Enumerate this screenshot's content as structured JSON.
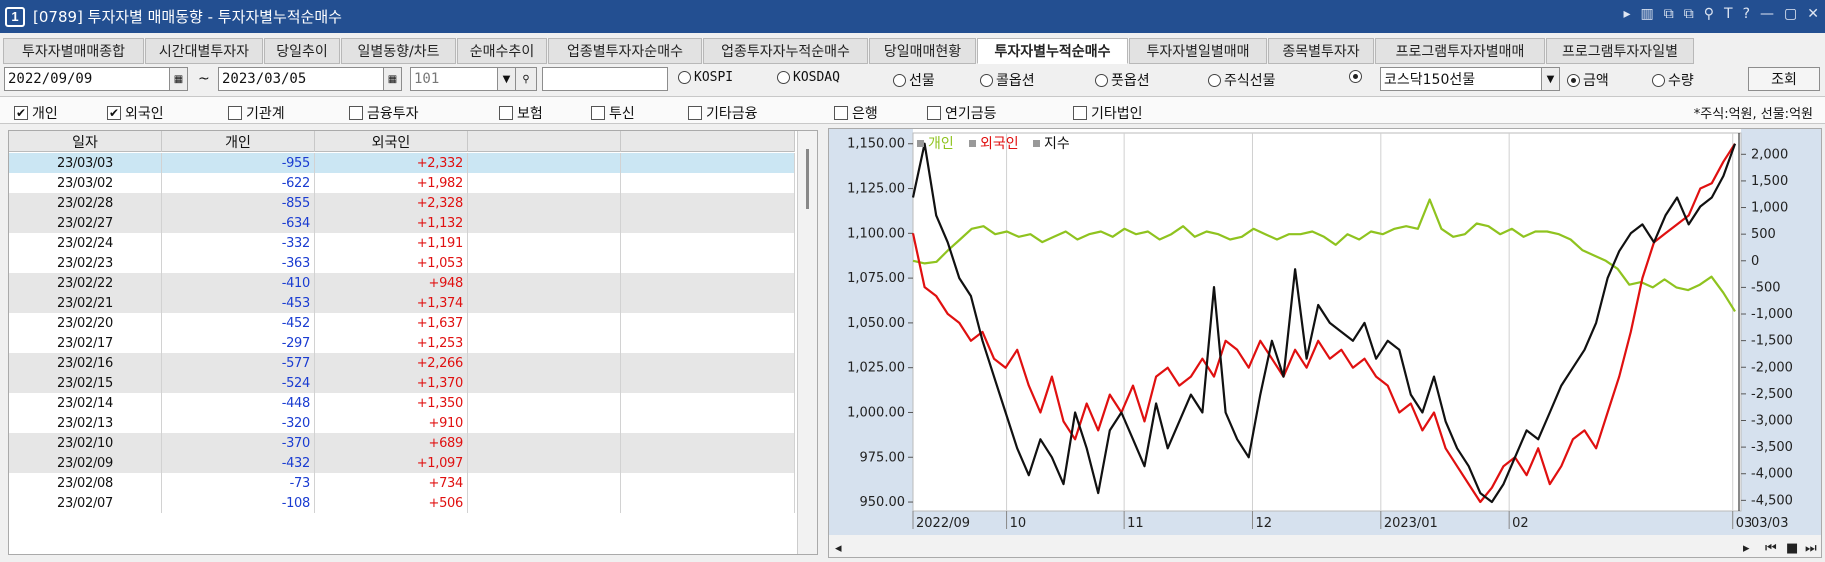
{
  "window": {
    "number": "1",
    "title": "[0789] 투자자별 매매동향 - 투자자별누적순매수",
    "controls": [
      "▸",
      "▥",
      "⧉",
      "⧉",
      "⚲",
      "T",
      "?",
      "—",
      "▢",
      "✕"
    ]
  },
  "tabs": [
    {
      "label": "투자자별매매종합",
      "active": false
    },
    {
      "label": "시간대별투자자",
      "active": false
    },
    {
      "label": "당일추이",
      "active": false
    },
    {
      "label": "일별동향/차트",
      "active": false
    },
    {
      "label": "순매수추이",
      "active": false
    },
    {
      "label": "업종별투자자순매수",
      "active": false
    },
    {
      "label": "업종투자자누적순매수",
      "active": false
    },
    {
      "label": "당일매매현황",
      "active": false
    },
    {
      "label": "투자자별누적순매수",
      "active": true
    },
    {
      "label": "투자자별일별매매",
      "active": false
    },
    {
      "label": "종목별투자자",
      "active": false
    },
    {
      "label": "프로그램투자자별매매",
      "active": false
    },
    {
      "label": "프로그램투자자일별",
      "active": false
    }
  ],
  "filter": {
    "start_date": "2022/09/09",
    "tilde": "~",
    "end_date": "2023/03/05",
    "code": "101",
    "radios": [
      {
        "label": "KOSPI",
        "selected": false
      },
      {
        "label": "KOSDAQ",
        "selected": false
      },
      {
        "label": "선물",
        "selected": false
      },
      {
        "label": "콜옵션",
        "selected": false
      },
      {
        "label": "풋옵션",
        "selected": false
      },
      {
        "label": "주식선물",
        "selected": false
      },
      {
        "label": "",
        "selected": true
      }
    ],
    "product": "코스닥150선물",
    "amount_label": "금액",
    "amount_selected": true,
    "qty_label": "수량",
    "qty_selected": false,
    "query_button": "조회"
  },
  "investors": [
    {
      "label": "개인",
      "checked": true
    },
    {
      "label": "외국인",
      "checked": true
    },
    {
      "label": "기관계",
      "checked": false
    },
    {
      "label": "금융투자",
      "checked": false
    },
    {
      "label": "보험",
      "checked": false
    },
    {
      "label": "투신",
      "checked": false
    },
    {
      "label": "기타금융",
      "checked": false
    },
    {
      "label": "은행",
      "checked": false
    },
    {
      "label": "연기금등",
      "checked": false
    },
    {
      "label": "기타법인",
      "checked": false
    }
  ],
  "unit_note": "*주식:억원, 선물:억원",
  "table": {
    "headers": [
      "일자",
      "개인",
      "외국인",
      "",
      ""
    ],
    "rows": [
      {
        "date": "23/03/03",
        "individual": "-955",
        "foreign": "+2,332"
      },
      {
        "date": "23/03/02",
        "individual": "-622",
        "foreign": "+1,982"
      },
      {
        "date": "23/02/28",
        "individual": "-855",
        "foreign": "+2,328"
      },
      {
        "date": "23/02/27",
        "individual": "-634",
        "foreign": "+1,132"
      },
      {
        "date": "23/02/24",
        "individual": "-332",
        "foreign": "+1,191"
      },
      {
        "date": "23/02/23",
        "individual": "-363",
        "foreign": "+1,053"
      },
      {
        "date": "23/02/22",
        "individual": "-410",
        "foreign": "+948"
      },
      {
        "date": "23/02/21",
        "individual": "-453",
        "foreign": "+1,374"
      },
      {
        "date": "23/02/20",
        "individual": "-452",
        "foreign": "+1,637"
      },
      {
        "date": "23/02/17",
        "individual": "-297",
        "foreign": "+1,253"
      },
      {
        "date": "23/02/16",
        "individual": "-577",
        "foreign": "+2,266"
      },
      {
        "date": "23/02/15",
        "individual": "-524",
        "foreign": "+1,370"
      },
      {
        "date": "23/02/14",
        "individual": "-448",
        "foreign": "+1,350"
      },
      {
        "date": "23/02/13",
        "individual": "-320",
        "foreign": "+910"
      },
      {
        "date": "23/02/10",
        "individual": "-370",
        "foreign": "+689"
      },
      {
        "date": "23/02/09",
        "individual": "-432",
        "foreign": "+1,097"
      },
      {
        "date": "23/02/08",
        "individual": "-73",
        "foreign": "+734"
      },
      {
        "date": "23/02/07",
        "individual": "-108",
        "foreign": "+506"
      }
    ]
  },
  "chart_data": {
    "type": "line",
    "legend": [
      "개인",
      "외국인",
      "지수"
    ],
    "x_labels": [
      "2022/09",
      "10",
      "11",
      "12",
      "2023/01",
      "02",
      "03",
      "03/03"
    ],
    "left_axis": {
      "ticks": [
        "1,150.00",
        "1,125.00",
        "1,100.00",
        "1,075.00",
        "1,050.00",
        "1,025.00",
        "1,000.00",
        "975.00",
        "950.00"
      ],
      "range": [
        945,
        1156
      ]
    },
    "right_axis": {
      "ticks": [
        "2,000",
        "1,500",
        "1,000",
        "500",
        "0",
        "-500",
        "-1,000",
        "-1,500",
        "-2,000",
        "-2,500",
        "-3,000",
        "-3,500",
        "-4,000",
        "-4,500"
      ],
      "range": [
        -4700,
        2400
      ]
    },
    "colors": {
      "개인": "#8fc31f",
      "외국인": "#e01010",
      "지수": "#111111"
    },
    "series": [
      {
        "name": "개인",
        "axis": "right",
        "values": [
          0,
          -50,
          -20,
          200,
          400,
          600,
          650,
          500,
          550,
          450,
          500,
          350,
          450,
          550,
          400,
          500,
          550,
          450,
          600,
          500,
          550,
          400,
          500,
          650,
          450,
          550,
          500,
          400,
          450,
          600,
          500,
          400,
          500,
          500,
          550,
          450,
          300,
          500,
          400,
          550,
          500,
          600,
          650,
          600,
          1150,
          600,
          450,
          500,
          700,
          650,
          500,
          600,
          450,
          550,
          550,
          500,
          400,
          200,
          100,
          0,
          -150,
          -450,
          -400,
          -500,
          -350,
          -500,
          -550,
          -450,
          -300,
          -600,
          -950
        ]
      },
      {
        "name": "외국인",
        "axis": "left",
        "values": [
          1100,
          1070,
          1065,
          1055,
          1050,
          1040,
          1045,
          1030,
          1025,
          1035,
          1015,
          1000,
          1020,
          995,
          985,
          1005,
          990,
          1010,
          1000,
          1015,
          995,
          1020,
          1025,
          1015,
          1020,
          1030,
          1020,
          1040,
          1035,
          1025,
          1040,
          1030,
          1020,
          1035,
          1025,
          1040,
          1030,
          1035,
          1025,
          1030,
          1020,
          1015,
          1000,
          1005,
          990,
          1000,
          980,
          970,
          960,
          950,
          958,
          970,
          975,
          965,
          980,
          960,
          970,
          985,
          990,
          980,
          1000,
          1020,
          1045,
          1075,
          1095,
          1100,
          1105,
          1110,
          1125,
          1128,
          1140,
          1150
        ]
      },
      {
        "name": "지수",
        "axis": "left",
        "values": [
          1120,
          1150,
          1110,
          1095,
          1075,
          1065,
          1040,
          1020,
          1000,
          980,
          965,
          985,
          975,
          960,
          1000,
          980,
          955,
          990,
          1000,
          985,
          970,
          1005,
          980,
          995,
          1010,
          1000,
          1070,
          1000,
          985,
          975,
          1010,
          1040,
          1020,
          1080,
          1030,
          1060,
          1050,
          1045,
          1040,
          1050,
          1030,
          1040,
          1035,
          1010,
          1000,
          1020,
          995,
          980,
          970,
          955,
          950,
          960,
          975,
          990,
          985,
          1000,
          1015,
          1025,
          1035,
          1050,
          1075,
          1090,
          1100,
          1105,
          1095,
          1110,
          1120,
          1105,
          1115,
          1120,
          1132,
          1150
        ]
      }
    ]
  }
}
